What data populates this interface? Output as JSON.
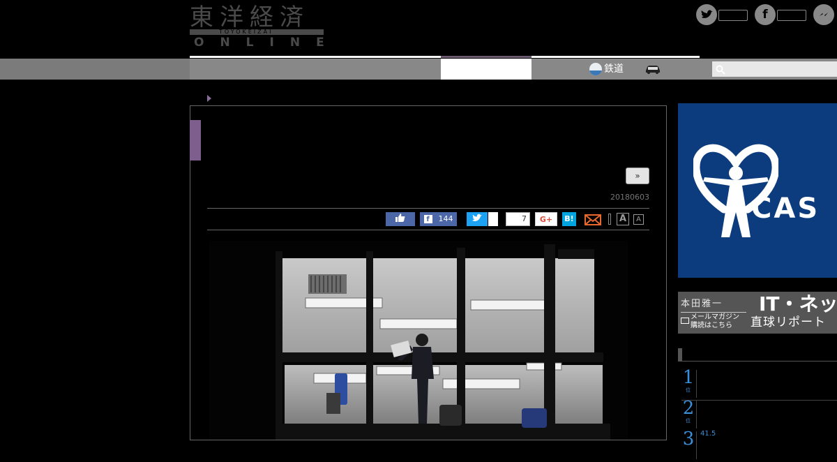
{
  "header": {
    "logo": {
      "kanji": "東洋経済",
      "roman": "TOYOKEIZAI",
      "online": "ONLINE"
    },
    "social": [
      {
        "name": "twitter",
        "icon": "twitter-icon",
        "glyph": "t"
      },
      {
        "name": "facebook",
        "icon": "facebook-icon",
        "glyph": "f"
      },
      {
        "name": "messenger",
        "icon": "messenger-icon",
        "glyph": "~"
      }
    ]
  },
  "nav": {
    "rail_label": "鉄道",
    "search_placeholder": ""
  },
  "article": {
    "next_label": "»",
    "date": "20180603",
    "share": {
      "facebook_count": "144",
      "hatena_count": "7",
      "gplus_label": "G+",
      "hatena_label": "B!",
      "font_large": "A",
      "font_small": "A"
    }
  },
  "sidebar": {
    "ad_text": "CAS",
    "ad_reg": "®",
    "banner": {
      "name": "本田雅一",
      "mail": "メールマガジン 購読はこちら",
      "title_line1": "IT・ネット",
      "title_line2": "直球リポート"
    },
    "ranking": [
      {
        "rank": "1",
        "suffix": "位",
        "meta": ""
      },
      {
        "rank": "2",
        "suffix": "位",
        "meta": ""
      },
      {
        "rank": "3",
        "suffix": "位",
        "meta": "41.5"
      }
    ]
  },
  "colors": {
    "background": "#000000",
    "nav_gray": "#888888",
    "accent_purple": "#7d5e8c",
    "facebook_blue": "#4b67a8",
    "twitter_blue": "#1da1f2",
    "hatena_blue": "#00a4de",
    "ad_blue": "#0c3b7e",
    "rank_blue": "#3b8fd9"
  }
}
